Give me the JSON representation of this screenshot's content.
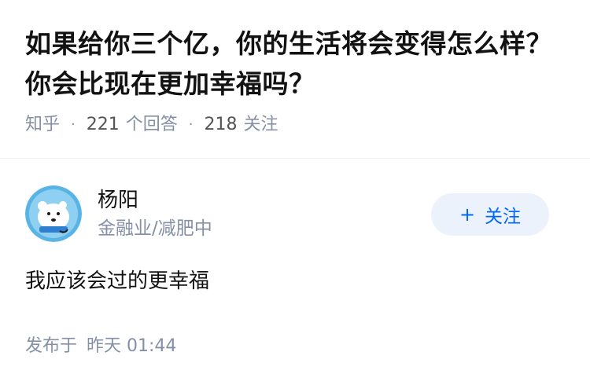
{
  "question": {
    "title": "如果给你三个亿，你的生活将会变得怎么样？你会比现在更加幸福吗？",
    "source": "知乎",
    "answer_count": "221",
    "answer_label": "个回答",
    "follower_count": "218",
    "follower_label": "关注"
  },
  "answer": {
    "author_name": "杨阳",
    "author_headline": "金融业/减肥中",
    "follow_plus": "+",
    "follow_label": "关注",
    "content": "我应该会过的更幸福",
    "publish_prefix": "发布于",
    "publish_time": "昨天 01:44"
  },
  "colors": {
    "accent": "#0066ff",
    "accent_bg": "#ebf2fc",
    "meta_gray": "#8590a6"
  }
}
